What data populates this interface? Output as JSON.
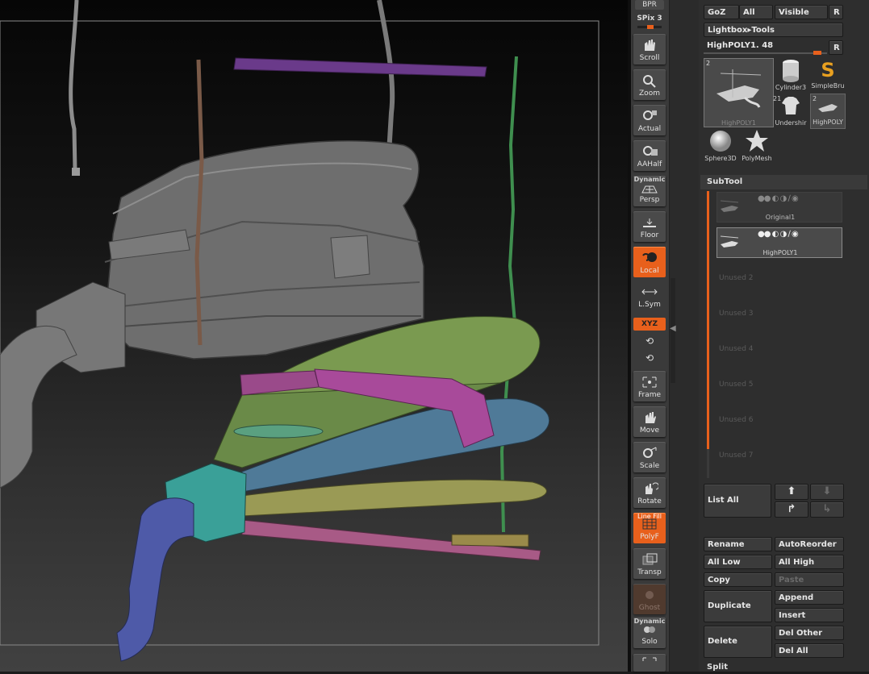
{
  "shelf": {
    "bpr": "BPR",
    "spix": "SPix 3",
    "buttons": [
      {
        "label": "Scroll",
        "icon": "scroll-icon",
        "state": "normal"
      },
      {
        "label": "Zoom",
        "icon": "zoom-icon",
        "state": "normal"
      },
      {
        "label": "Actual",
        "icon": "actual-icon",
        "state": "normal"
      },
      {
        "label": "AAHalf",
        "icon": "aahalf-icon",
        "state": "normal"
      },
      {
        "label": "Persp",
        "icon": "persp-icon",
        "state": "normal"
      },
      {
        "label": "Floor",
        "icon": "floor-icon",
        "state": "normal"
      },
      {
        "label": "Local",
        "icon": "local-icon",
        "state": "active"
      },
      {
        "label": "L.Sym",
        "icon": "lsym-icon",
        "state": "normal"
      },
      {
        "label": "Frame",
        "icon": "frame-icon",
        "state": "normal"
      },
      {
        "label": "Move",
        "icon": "move-icon",
        "state": "normal"
      },
      {
        "label": "Scale",
        "icon": "scale-icon",
        "state": "normal"
      },
      {
        "label": "Rotate",
        "icon": "rotate-icon",
        "state": "normal"
      },
      {
        "label": "PolyF",
        "icon": "polyf-icon",
        "state": "active"
      },
      {
        "label": "Transp",
        "icon": "transp-icon",
        "state": "normal"
      },
      {
        "label": "Ghost",
        "icon": "ghost-icon",
        "state": "disabled"
      },
      {
        "label": "Solo",
        "icon": "solo-icon",
        "state": "normal"
      }
    ],
    "dynamic_label": "Dynamic",
    "dynamic_label_2": "Dynamic",
    "xyz": "XYZ",
    "line_fill": "Line Fill"
  },
  "tool": {
    "goz": "GoZ",
    "all": "All",
    "visible": "Visible",
    "r": "R",
    "lightbox_tools": "Lightbox▸Tools",
    "current_tool": "HighPOLY1. 48",
    "r2": "R",
    "thumbs": [
      {
        "name": "HighPOLY1",
        "badge": "2"
      },
      {
        "name": "Cylinder3",
        "badge": ""
      },
      {
        "name": "SimpleBru",
        "badge": ""
      },
      {
        "name": "Undershir",
        "badge": "21"
      },
      {
        "name": "HighPOLY",
        "badge": "2"
      },
      {
        "name": "Sphere3D",
        "badge": ""
      },
      {
        "name": "PolyMesh",
        "badge": ""
      }
    ]
  },
  "subtool": {
    "title": "SubTool",
    "items": [
      {
        "name": "Original1",
        "selected": false
      },
      {
        "name": "HighPOLY1",
        "selected": true
      }
    ],
    "unused": [
      "Unused 2",
      "Unused 3",
      "Unused 4",
      "Unused 5",
      "Unused 6",
      "Unused 7"
    ],
    "list_all": "List All",
    "rename": "Rename",
    "auto_reorder": "AutoReorder",
    "all_low": "All Low",
    "all_high": "All High",
    "copy": "Copy",
    "paste": "Paste",
    "duplicate": "Duplicate",
    "append": "Append",
    "insert": "Insert",
    "delete": "Delete",
    "del_other": "Del Other",
    "del_all": "Del All",
    "split": "Split"
  }
}
